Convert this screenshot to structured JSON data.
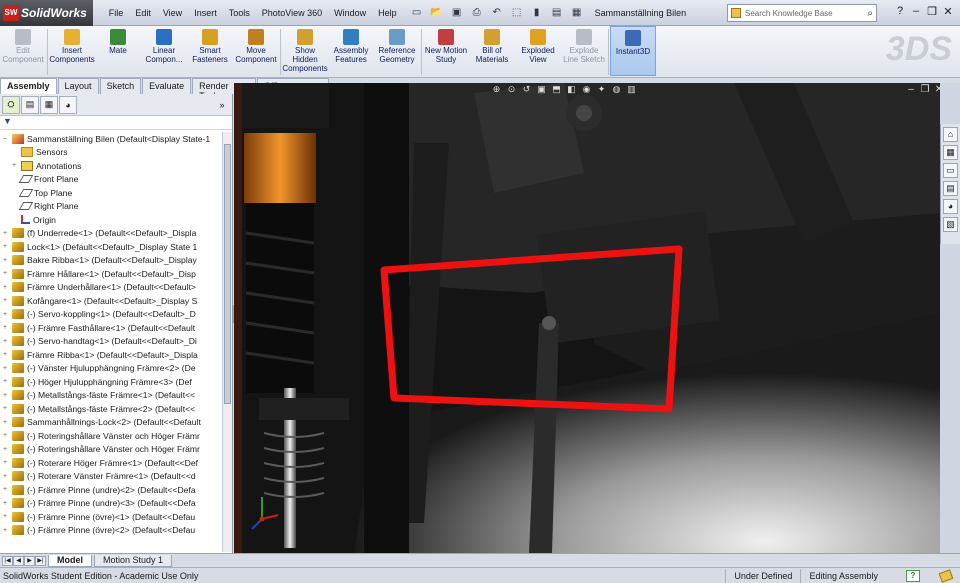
{
  "app": {
    "name": "SolidWorks",
    "badge": "SW",
    "document_title": "Sammanställning Bilen"
  },
  "menu": [
    "File",
    "Edit",
    "View",
    "Insert",
    "Tools",
    "PhotoView 360",
    "Window",
    "Help"
  ],
  "search": {
    "placeholder": "Search Knowledge Base"
  },
  "commands": [
    {
      "label": "Edit Component",
      "disabled": true
    },
    {
      "label": "Insert Components"
    },
    {
      "label": "Mate"
    },
    {
      "label": "Linear Compon..."
    },
    {
      "label": "Smart Fasteners"
    },
    {
      "label": "Move Component"
    },
    {
      "label": "Show Hidden Components"
    },
    {
      "label": "Assembly Features"
    },
    {
      "label": "Reference Geometry"
    },
    {
      "label": "New Motion Study"
    },
    {
      "label": "Bill of Materials"
    },
    {
      "label": "Exploded View"
    },
    {
      "label": "Explode Line Sketch",
      "disabled": true
    },
    {
      "label": "Instant3D",
      "active": true
    }
  ],
  "tabs": [
    "Assembly",
    "Layout",
    "Sketch",
    "Evaluate",
    "Render Tools",
    "Office Products"
  ],
  "tree": {
    "root": "Sammanställning Bilen  (Default<Display State-1",
    "items": [
      {
        "label": "Sensors",
        "icon": "folder",
        "sub": true
      },
      {
        "label": "Annotations",
        "icon": "ann",
        "sub": true,
        "exp": "+"
      },
      {
        "label": "Front Plane",
        "icon": "plane",
        "sub": true
      },
      {
        "label": "Top Plane",
        "icon": "plane",
        "sub": true
      },
      {
        "label": "Right Plane",
        "icon": "plane",
        "sub": true
      },
      {
        "label": "Origin",
        "icon": "origin",
        "sub": true
      },
      {
        "label": "(f) Underrede<1> (Default<<Default>_Displa",
        "icon": "part",
        "exp": "+"
      },
      {
        "label": "Lock<1> (Default<<Default>_Display State 1",
        "icon": "part",
        "exp": "+"
      },
      {
        "label": "Bakre Ribba<1> (Default<<Default>_Display",
        "icon": "part",
        "exp": "+"
      },
      {
        "label": "Främre Hållare<1> (Default<<Default>_Disp",
        "icon": "part",
        "exp": "+"
      },
      {
        "label": "Främre Underhållare<1> (Default<<Default>",
        "icon": "part",
        "exp": "+"
      },
      {
        "label": "Kofångare<1> (Default<<Default>_Display S",
        "icon": "part",
        "exp": "+"
      },
      {
        "label": "(-) Servo-koppling<1> (Default<<Default>_D",
        "icon": "part",
        "exp": "+"
      },
      {
        "label": "(-) Främre Fasthållare<1> (Default<<Default",
        "icon": "part",
        "exp": "+"
      },
      {
        "label": "(-) Servo-handtag<1> (Default<<Default>_Di",
        "icon": "part",
        "exp": "+"
      },
      {
        "label": "Främre Ribba<1> (Default<<Default>_Displa",
        "icon": "part",
        "exp": "+"
      },
      {
        "label": "(-) Vänster Hjulupphängning Främre<2> (De",
        "icon": "part",
        "exp": "+"
      },
      {
        "label": "(-) Höger Hjulupphängning Främre<3> (Def",
        "icon": "part",
        "exp": "+"
      },
      {
        "label": "(-) Metallstångs-fäste Främre<1> (Default<<",
        "icon": "part",
        "exp": "+"
      },
      {
        "label": "(-) Metallstångs-fäste Främre<2> (Default<<",
        "icon": "part",
        "exp": "+"
      },
      {
        "label": "Sammanhållnings-Lock<2> (Default<<Default",
        "icon": "part",
        "exp": "+"
      },
      {
        "label": "(-) Roteringshållare Vänster och Höger Främr",
        "icon": "part",
        "exp": "+"
      },
      {
        "label": "(-) Roteringshållare Vänster och Höger Främr",
        "icon": "part",
        "exp": "+"
      },
      {
        "label": "(-) Roterare Höger Främre<1> (Default<<Def",
        "icon": "part",
        "exp": "+"
      },
      {
        "label": "(-) Roterare Vänster Främre<1> (Default<<d",
        "icon": "part",
        "exp": "+"
      },
      {
        "label": "(-) Främre Pinne (undre)<2> (Default<<Defa",
        "icon": "part",
        "exp": "+"
      },
      {
        "label": "(-) Främre Pinne (undre)<3> (Default<<Defa",
        "icon": "part",
        "exp": "+"
      },
      {
        "label": "(-) Främre Pinne (övre)<1> (Default<<Defau",
        "icon": "part",
        "exp": "+"
      },
      {
        "label": "(-) Främre Pinne (övre)<2> (Default<<Defau",
        "icon": "part",
        "exp": "+"
      }
    ]
  },
  "bottom_tabs": [
    "Model",
    "Motion Study 1"
  ],
  "status": {
    "left": "SolidWorks Student Edition - Academic Use Only",
    "state": "Under Defined",
    "mode": "Editing Assembly",
    "help": "?"
  },
  "colors": {
    "highlight_box": "#ee1111",
    "shock_orange": "#e08020"
  }
}
